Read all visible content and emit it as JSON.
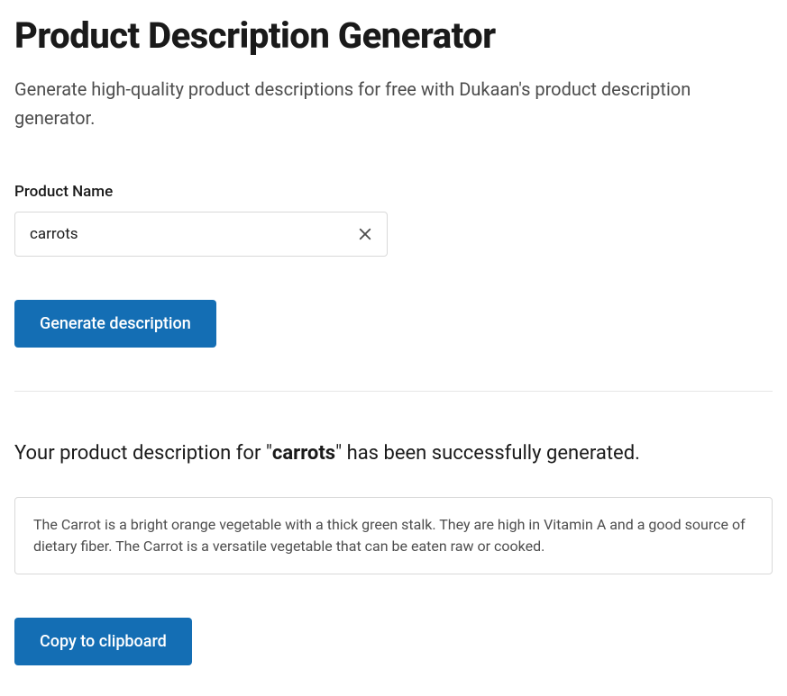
{
  "header": {
    "title": "Product Description Generator",
    "subtitle": "Generate high-quality product descriptions for free with Dukaan's product description generator."
  },
  "form": {
    "product_label": "Product Name",
    "product_value": "carrots",
    "generate_button": "Generate description"
  },
  "result": {
    "message_prefix": "Your product description for \"",
    "product_name": "carrots",
    "message_suffix": "\" has been successfully generated.",
    "description": "The Carrot is a bright orange vegetable with a thick green stalk. They are high in Vitamin A and a good source of dietary fiber. The Carrot is a versatile vegetable that can be eaten raw or cooked.",
    "copy_button": "Copy to clipboard"
  }
}
